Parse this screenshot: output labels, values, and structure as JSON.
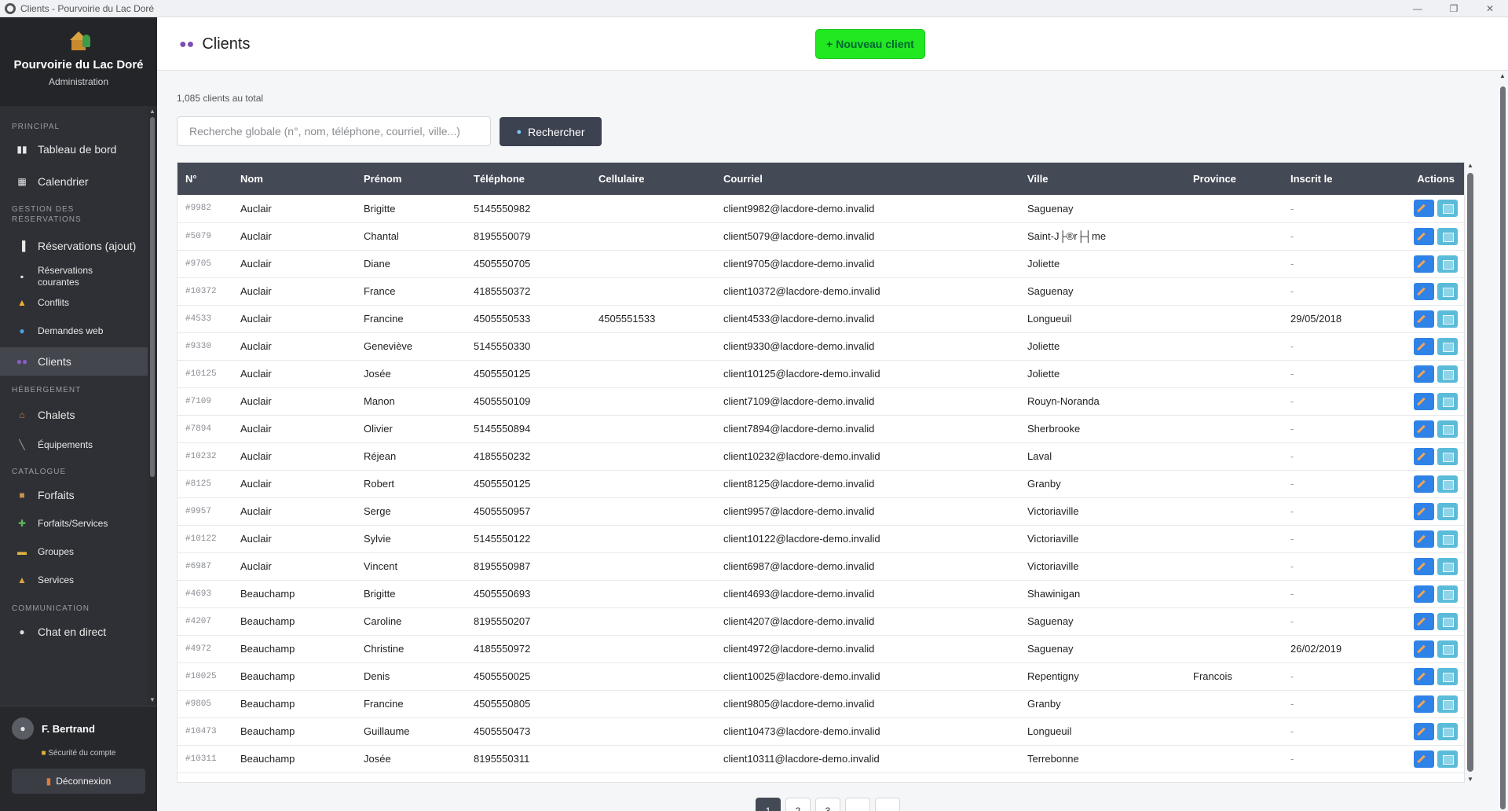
{
  "window": {
    "title": "Clients - Pourvoirie du Lac Doré",
    "minimize": "—",
    "maximize": "❐",
    "close": "✕"
  },
  "brand": {
    "name": "Pourvoirie du Lac Doré",
    "subtitle": "Administration"
  },
  "nav": {
    "principal": "PRINCIPAL",
    "dashboard": "Tableau de bord",
    "calendar": "Calendrier",
    "reservations_section": "GESTION DES RÉSERVATIONS",
    "reservations_add": "Réservations (ajout)",
    "reservations_current": "Réservations courantes",
    "conflicts": "Conflits",
    "web_requests": "Demandes web",
    "clients": "Clients",
    "lodging_section": "HÉBERGEMENT",
    "chalets": "Chalets",
    "equipment": "Équipements",
    "catalog_section": "CATALOGUE",
    "packages": "Forfaits",
    "packages_services": "Forfaits/Services",
    "groups": "Groupes",
    "services": "Services",
    "communication_section": "COMMUNICATION",
    "live_chat": "Chat en direct"
  },
  "user": {
    "name": "F. Bertrand",
    "security": "Sécurité du compte",
    "logout": "Déconnexion"
  },
  "header": {
    "title": "Clients",
    "new_client": "+ Nouveau client"
  },
  "summary": {
    "total": "1,085 clients au total"
  },
  "search": {
    "placeholder": "Recherche globale (n°, nom, téléphone, courriel, ville...)",
    "button": "Rechercher"
  },
  "table": {
    "columns": [
      "N°",
      "Nom",
      "Prénom",
      "Téléphone",
      "Cellulaire",
      "Courriel",
      "Ville",
      "Province",
      "Inscrit le",
      "Actions"
    ],
    "rows": [
      [
        "#9982",
        "Auclair",
        "Brigitte",
        "5145550982",
        "",
        "client9982@lacdore-demo.invalid",
        "Saguenay",
        "",
        "-"
      ],
      [
        "#5079",
        "Auclair",
        "Chantal",
        "8195550079",
        "",
        "client5079@lacdore-demo.invalid",
        "Saint-J├®r├┤me",
        "",
        "-"
      ],
      [
        "#9705",
        "Auclair",
        "Diane",
        "4505550705",
        "",
        "client9705@lacdore-demo.invalid",
        "Joliette",
        "",
        "-"
      ],
      [
        "#10372",
        "Auclair",
        "France",
        "4185550372",
        "",
        "client10372@lacdore-demo.invalid",
        "Saguenay",
        "",
        "-"
      ],
      [
        "#4533",
        "Auclair",
        "Francine",
        "4505550533",
        "4505551533",
        "client4533@lacdore-demo.invalid",
        "Longueuil",
        "",
        "29/05/2018"
      ],
      [
        "#9330",
        "Auclair",
        "Geneviève",
        "5145550330",
        "",
        "client9330@lacdore-demo.invalid",
        "Joliette",
        "",
        "-"
      ],
      [
        "#10125",
        "Auclair",
        "Josée",
        "4505550125",
        "",
        "client10125@lacdore-demo.invalid",
        "Joliette",
        "",
        "-"
      ],
      [
        "#7109",
        "Auclair",
        "Manon",
        "4505550109",
        "",
        "client7109@lacdore-demo.invalid",
        "Rouyn-Noranda",
        "",
        "-"
      ],
      [
        "#7894",
        "Auclair",
        "Olivier",
        "5145550894",
        "",
        "client7894@lacdore-demo.invalid",
        "Sherbrooke",
        "",
        "-"
      ],
      [
        "#10232",
        "Auclair",
        "Réjean",
        "4185550232",
        "",
        "client10232@lacdore-demo.invalid",
        "Laval",
        "",
        "-"
      ],
      [
        "#8125",
        "Auclair",
        "Robert",
        "4505550125",
        "",
        "client8125@lacdore-demo.invalid",
        "Granby",
        "",
        "-"
      ],
      [
        "#9957",
        "Auclair",
        "Serge",
        "4505550957",
        "",
        "client9957@lacdore-demo.invalid",
        "Victoriaville",
        "",
        "-"
      ],
      [
        "#10122",
        "Auclair",
        "Sylvie",
        "5145550122",
        "",
        "client10122@lacdore-demo.invalid",
        "Victoriaville",
        "",
        "-"
      ],
      [
        "#6987",
        "Auclair",
        "Vincent",
        "8195550987",
        "",
        "client6987@lacdore-demo.invalid",
        "Victoriaville",
        "",
        "-"
      ],
      [
        "#4693",
        "Beauchamp",
        "Brigitte",
        "4505550693",
        "",
        "client4693@lacdore-demo.invalid",
        "Shawinigan",
        "",
        "-"
      ],
      [
        "#4207",
        "Beauchamp",
        "Caroline",
        "8195550207",
        "",
        "client4207@lacdore-demo.invalid",
        "Saguenay",
        "",
        "-"
      ],
      [
        "#4972",
        "Beauchamp",
        "Christine",
        "4185550972",
        "",
        "client4972@lacdore-demo.invalid",
        "Saguenay",
        "",
        "26/02/2019"
      ],
      [
        "#10025",
        "Beauchamp",
        "Denis",
        "4505550025",
        "",
        "client10025@lacdore-demo.invalid",
        "Repentigny",
        "Francois",
        "-"
      ],
      [
        "#9805",
        "Beauchamp",
        "Francine",
        "4505550805",
        "",
        "client9805@lacdore-demo.invalid",
        "Granby",
        "",
        "-"
      ],
      [
        "#10473",
        "Beauchamp",
        "Guillaume",
        "4505550473",
        "",
        "client10473@lacdore-demo.invalid",
        "Longueuil",
        "",
        "-"
      ],
      [
        "#10311",
        "Beauchamp",
        "Josée",
        "8195550311",
        "",
        "client10311@lacdore-demo.invalid",
        "Terrebonne",
        "",
        "-"
      ]
    ]
  },
  "pagination": [
    "1",
    "2",
    "3",
    "",
    ""
  ],
  "colors": {
    "accent_green": "#22e822",
    "table_header": "#434955",
    "edit_blue": "#2f82e6",
    "calendar_teal": "#5bbcd9",
    "sidebar": "#2e3035"
  }
}
